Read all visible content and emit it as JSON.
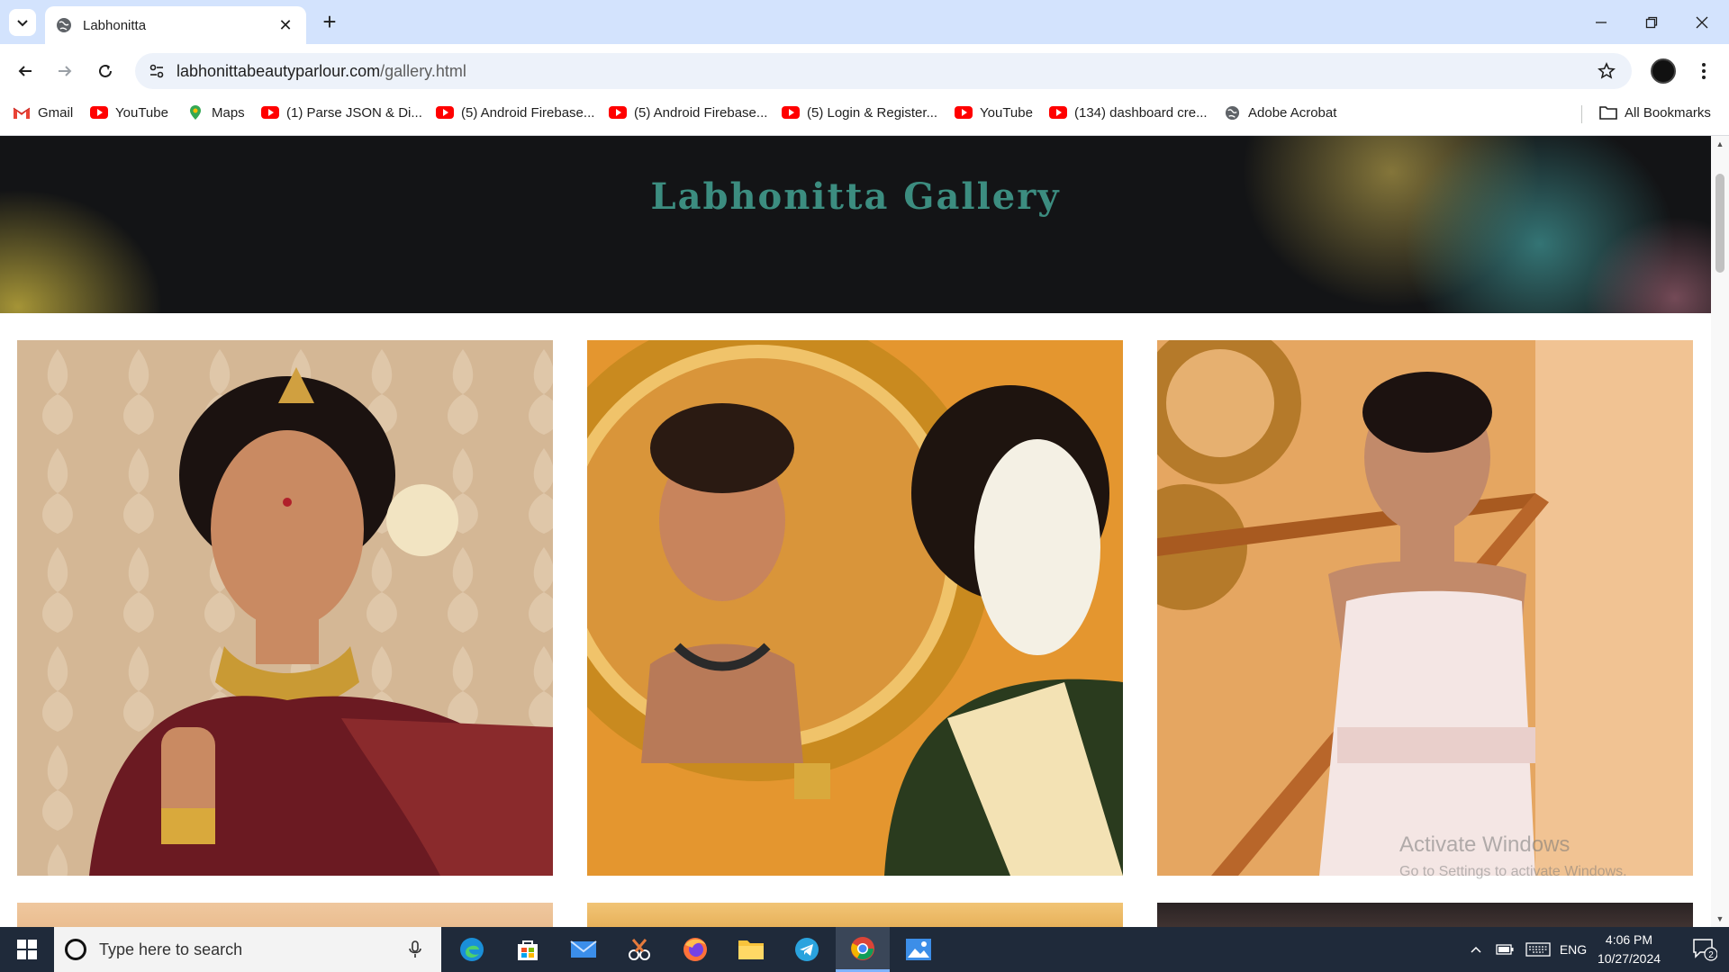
{
  "browser": {
    "tab_title": "Labhonitta",
    "url_host": "labhonittabeautyparlour.com",
    "url_path": "/gallery.html",
    "bookmarks": [
      {
        "label": "Gmail",
        "icon": "gmail-icon"
      },
      {
        "label": "YouTube",
        "icon": "youtube-icon"
      },
      {
        "label": "Maps",
        "icon": "maps-icon"
      },
      {
        "label": "(1) Parse JSON & Di...",
        "icon": "youtube-icon"
      },
      {
        "label": "(5) Android Firebase...",
        "icon": "youtube-icon"
      },
      {
        "label": "(5) Android Firebase...",
        "icon": "youtube-icon"
      },
      {
        "label": "(5) Login & Register...",
        "icon": "youtube-icon"
      },
      {
        "label": "YouTube",
        "icon": "youtube-icon"
      },
      {
        "label": "(134) dashboard cre...",
        "icon": "youtube-icon"
      },
      {
        "label": "Adobe Acrobat",
        "icon": "globe-icon"
      }
    ],
    "all_bookmarks_label": "All Bookmarks"
  },
  "page": {
    "hero_title": "Labhonitta Gallery",
    "gallery": [
      {
        "alt": "Bride in maroon saree with gold jewellery"
      },
      {
        "alt": "Bride looking into golden mirror"
      },
      {
        "alt": "Model in white gown on staircase"
      },
      {
        "alt": "Gallery photo 4"
      },
      {
        "alt": "Gallery photo 5"
      },
      {
        "alt": "Gallery photo 6"
      }
    ]
  },
  "watermark": {
    "line1": "Activate Windows",
    "line2": "Go to Settings to activate Windows."
  },
  "taskbar": {
    "search_placeholder": "Type here to search",
    "language": "ENG",
    "time": "4:06 PM",
    "date": "10/27/2024",
    "notification_count": "2"
  },
  "colors": {
    "hero_title": "#3c8d80",
    "hero_bg": "#131416",
    "tabstrip": "#d3e3fd"
  }
}
